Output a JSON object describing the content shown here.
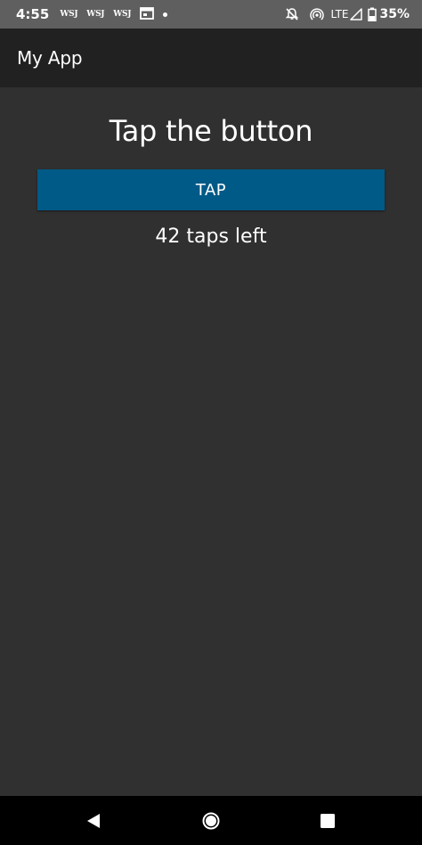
{
  "status_bar": {
    "time": "4:55",
    "notifications": [
      "WSJ",
      "WSJ",
      "WSJ"
    ],
    "network": "LTE",
    "battery": "35%",
    "icons": [
      "calendar-icon",
      "dot-icon",
      "mute-icon",
      "hotspot-icon",
      "signal-icon",
      "battery-icon"
    ]
  },
  "app_bar": {
    "title": "My App"
  },
  "main": {
    "heading": "Tap the button",
    "button_label": "TAP",
    "counter_text": "42 taps left",
    "button_color": "#005a87"
  },
  "nav_bar": {
    "icons": [
      "back-icon",
      "home-icon",
      "recents-icon"
    ]
  },
  "colors": {
    "status_bar": "#5f5f5f",
    "app_bar": "#212121",
    "background": "#303030",
    "nav_bar": "#000000"
  }
}
